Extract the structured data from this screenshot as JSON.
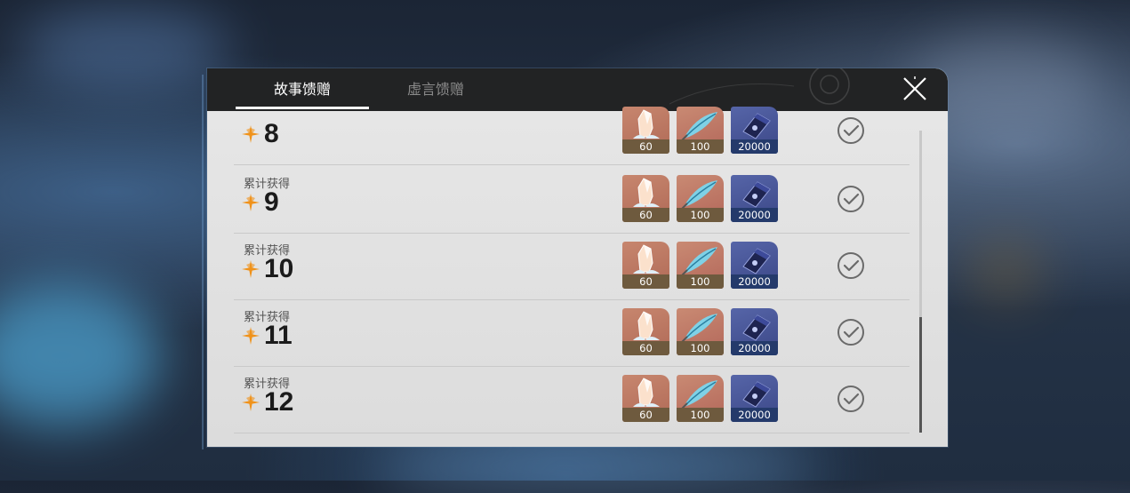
{
  "tabs": [
    {
      "label": "故事馈赠",
      "active": true
    },
    {
      "label": "虚言馈赠",
      "active": false
    }
  ],
  "close_icon": "close-icon",
  "colors": {
    "star": "#f0921a",
    "header": "#222324",
    "panel": "#e3e3e3"
  },
  "rows": [
    {
      "label": "",
      "value": "8",
      "rewards": [
        "60",
        "100",
        "20000"
      ],
      "claimed": true
    },
    {
      "label": "累计获得",
      "value": "9",
      "rewards": [
        "60",
        "100",
        "20000"
      ],
      "claimed": true
    },
    {
      "label": "累计获得",
      "value": "10",
      "rewards": [
        "60",
        "100",
        "20000"
      ],
      "claimed": true
    },
    {
      "label": "累计获得",
      "value": "11",
      "rewards": [
        "60",
        "100",
        "20000"
      ],
      "claimed": true
    },
    {
      "label": "累计获得",
      "value": "12",
      "rewards": [
        "60",
        "100",
        "20000"
      ],
      "claimed": true
    }
  ]
}
